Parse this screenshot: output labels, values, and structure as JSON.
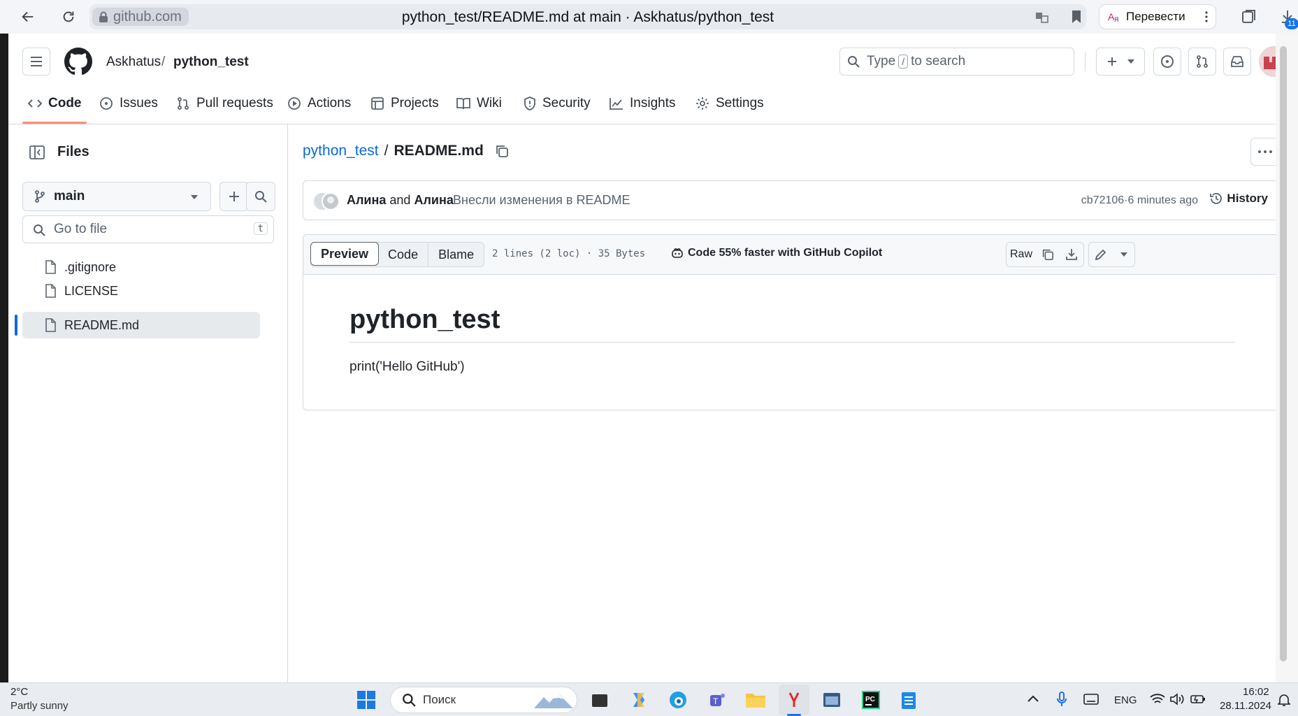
{
  "browser": {
    "domain": "github.com",
    "title": "python_test/README.md at main · Askhatus/python_test",
    "translate_label": "Перевести",
    "badge_count": "11"
  },
  "header": {
    "owner": "Askhatus",
    "separator": "/",
    "repo": "python_test",
    "search_prefix": "Type",
    "search_key": "/",
    "search_suffix": "to search"
  },
  "tabs": [
    {
      "label": "Code",
      "icon": "code-icon"
    },
    {
      "label": "Issues",
      "icon": "issue-icon"
    },
    {
      "label": "Pull requests",
      "icon": "pull-request-icon"
    },
    {
      "label": "Actions",
      "icon": "play-icon"
    },
    {
      "label": "Projects",
      "icon": "table-icon"
    },
    {
      "label": "Wiki",
      "icon": "book-icon"
    },
    {
      "label": "Security",
      "icon": "shield-icon"
    },
    {
      "label": "Insights",
      "icon": "graph-icon"
    },
    {
      "label": "Settings",
      "icon": "gear-icon"
    }
  ],
  "sidebar": {
    "title": "Files",
    "branch": "main",
    "goto_placeholder": "Go to file",
    "goto_key": "t",
    "files": [
      {
        "name": ".gitignore",
        "selected": false
      },
      {
        "name": "LICENSE",
        "selected": false
      },
      {
        "name": "README.md",
        "selected": true
      }
    ]
  },
  "breadcrumb": {
    "repo": "python_test",
    "separator": "/",
    "file": "README.md"
  },
  "commit": {
    "author1": "Алина",
    "and": "and",
    "author2": "Алина",
    "message": "Внесли изменения в README",
    "sha": "cb72106",
    "dot": "·",
    "time": "6 minutes ago",
    "history_label": "History"
  },
  "file_view": {
    "modes": [
      "Preview",
      "Code",
      "Blame"
    ],
    "active_mode": "Preview",
    "info": "2 lines (2 loc) · 35 Bytes",
    "copilot": "Code 55% faster with GitHub Copilot",
    "raw_label": "Raw"
  },
  "readme": {
    "heading": "python_test",
    "body": "print('Hello GitHub')"
  },
  "taskbar": {
    "temperature": "2°C",
    "weather": "Partly sunny",
    "search_placeholder": "Поиск",
    "language": "ENG",
    "time": "16:02",
    "date": "28.11.2024"
  },
  "colors": {
    "link": "#0969da",
    "tab_underline": "#fd8c73",
    "border": "#d1d9e0"
  }
}
